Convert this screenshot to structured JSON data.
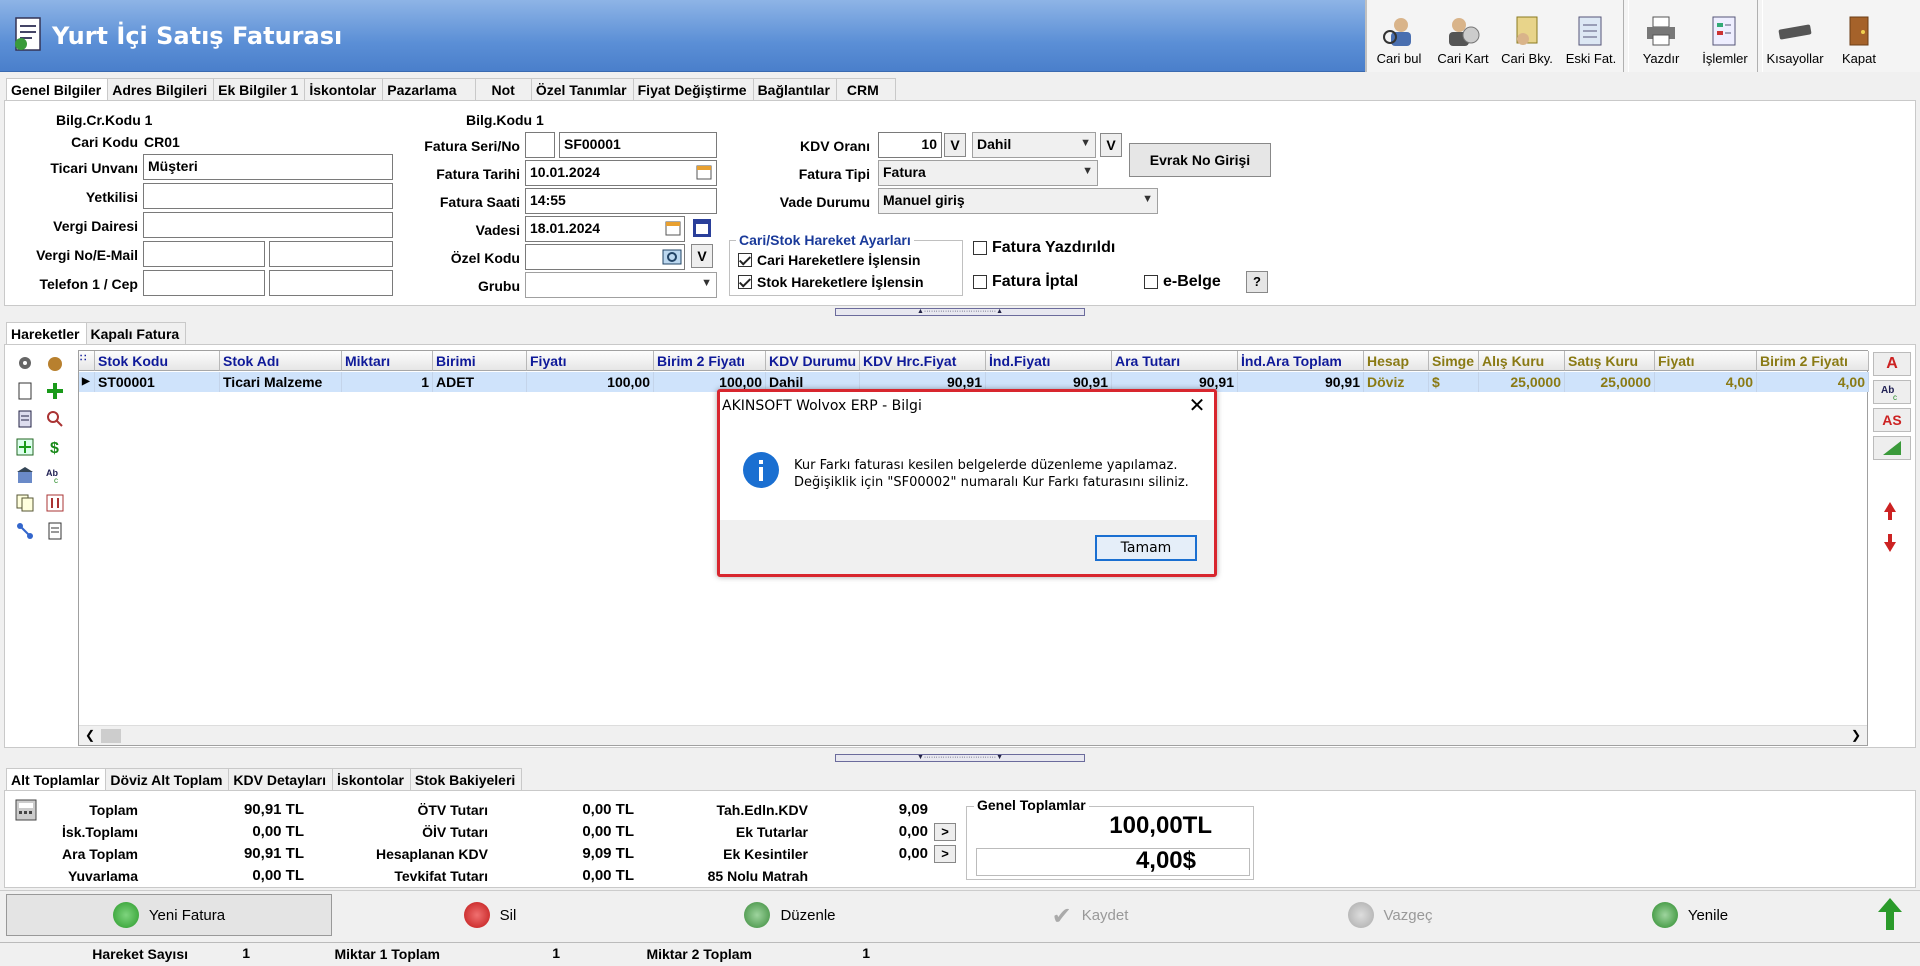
{
  "header": {
    "title": "Yurt İçi Satış Faturası",
    "toolbar": [
      "Cari bul",
      "Cari Kart",
      "Cari Bky.",
      "Eski Fat.",
      "Yazdır",
      "İşlemler",
      "Kısayollar",
      "Kapat"
    ]
  },
  "tabs": [
    "Genel Bilgiler",
    "Adres Bilgileri",
    "Ek Bilgiler 1",
    "İskontolar",
    "Pazarlama",
    "Not",
    "Özel Tanımlar",
    "Fiyat Değiştirme",
    "Bağlantılar",
    "CRM"
  ],
  "form": {
    "bilg_cr_kodu": "Bilg.Cr.Kodu 1",
    "cari_kodu_label": "Cari Kodu",
    "cari_kodu": "CR01",
    "ticari_unvani_label": "Ticari Unvanı",
    "ticari_unvani": "Müşteri",
    "yetkilisi_label": "Yetkilisi",
    "vergi_dairesi_label": "Vergi Dairesi",
    "vergi_no_label": "Vergi No/E-Mail",
    "telefon_label": "Telefon 1 / Cep",
    "bilg_kodu": "Bilg.Kodu 1",
    "fatura_seri_label": "Fatura Seri/No",
    "fatura_no": "SF00001",
    "fatura_tarihi_label": "Fatura Tarihi",
    "fatura_tarihi": "10.01.2024",
    "fatura_saati_label": "Fatura Saati",
    "fatura_saati": "14:55",
    "vadesi_label": "Vadesi",
    "vadesi": "18.01.2024",
    "ozel_kodu_label": "Özel Kodu",
    "grubu_label": "Grubu",
    "kdv_orani_label": "KDV Oranı",
    "kdv_orani": "10",
    "kdv_dahil": "Dahil",
    "fatura_tipi_label": "Fatura Tipi",
    "fatura_tipi": "Fatura",
    "vade_durumu_label": "Vade Durumu",
    "vade_durumu": "Manuel giriş",
    "v_label": "V",
    "evrak_no_button": "Evrak No Girişi",
    "hareket_group_title": "Cari/Stok Hareket Ayarları",
    "cari_hareket": "Cari Hareketlere İşlensin",
    "stok_hareket": "Stok Hareketlere İşlensin",
    "fatura_yazdirildi": "Fatura Yazdırıldı",
    "fatura_iptal": "Fatura İptal",
    "e_belge": "e-Belge",
    "help": "?"
  },
  "grid_tabs": [
    "Hareketler",
    "Kapalı Fatura"
  ],
  "grid": {
    "columns": [
      "Stok Kodu",
      "Stok Adı",
      "Miktarı",
      "Birimi",
      "Fiyatı",
      "Birim 2 Fiyatı",
      "KDV Durumu",
      "KDV Hrc.Fiyat",
      "İnd.Fiyatı",
      "Ara Tutarı",
      "İnd.Ara Toplam",
      "Hesap",
      "Simge",
      "Alış Kuru",
      "Satış Kuru",
      "Fiyatı",
      "Birim 2 Fiyatı"
    ],
    "row": [
      "ST00001",
      "Ticari Malzeme",
      "1",
      "ADET",
      "100,00",
      "100,00",
      "Dahil",
      "90,91",
      "90,91",
      "90,91",
      "90,91",
      "Döviz",
      "$",
      "25,0000",
      "25,0000",
      "4,00",
      "4,00"
    ]
  },
  "right_buttons": [
    "A",
    "AS"
  ],
  "sum_tabs": [
    "Alt Toplamlar",
    "Döviz Alt Toplam",
    "KDV Detayları",
    "İskontolar",
    "Stok Bakiyeleri"
  ],
  "sums": {
    "col1": [
      [
        "Toplam",
        "90,91 TL"
      ],
      [
        "İsk.Toplamı",
        "0,00 TL"
      ],
      [
        "Ara Toplam",
        "90,91 TL"
      ],
      [
        "Yuvarlama",
        "0,00 TL"
      ]
    ],
    "col2": [
      [
        "ÖTV Tutarı",
        "0,00 TL"
      ],
      [
        "ÖİV Tutarı",
        "0,00 TL"
      ],
      [
        "Hesaplanan KDV",
        "9,09 TL"
      ],
      [
        "Tevkifat Tutarı",
        "0,00 TL"
      ]
    ],
    "col3": [
      [
        "Tah.Edln.KDV",
        "9,09"
      ],
      [
        "Ek Tutarlar",
        "0,00"
      ],
      [
        "Ek Kesintiler",
        "0,00"
      ],
      [
        "85 Nolu Matrah",
        ""
      ]
    ],
    "genel_title": "Genel Toplamlar",
    "genel_tl": "100,00TL",
    "genel_usd": "4,00$",
    "arrow": ">"
  },
  "actions": [
    "Yeni Fatura",
    "Sil",
    "Düzenle",
    "Kaydet",
    "Vazgeç",
    "Yenile"
  ],
  "status": {
    "hareket_sayisi_label": "Hareket Sayısı",
    "hareket_sayisi": "1",
    "miktar1_label": "Miktar 1 Toplam",
    "miktar1": "1",
    "miktar2_label": "Miktar 2 Toplam",
    "miktar2": "1"
  },
  "dialog": {
    "title": "AKINSOFT Wolvox ERP - Bilgi",
    "line1": "Kur Farkı faturası kesilen belgelerde düzenleme yapılamaz.",
    "line2": "Değişiklik için \"SF00002\" numaralı Kur Farkı faturasını siliniz.",
    "ok": "Tamam"
  },
  "colors": {
    "header_blue": "#5b8fd6",
    "grid_selection": "#cfe3fb",
    "dialog_border": "#d8262e",
    "info_blue": "#1a6fd1"
  }
}
